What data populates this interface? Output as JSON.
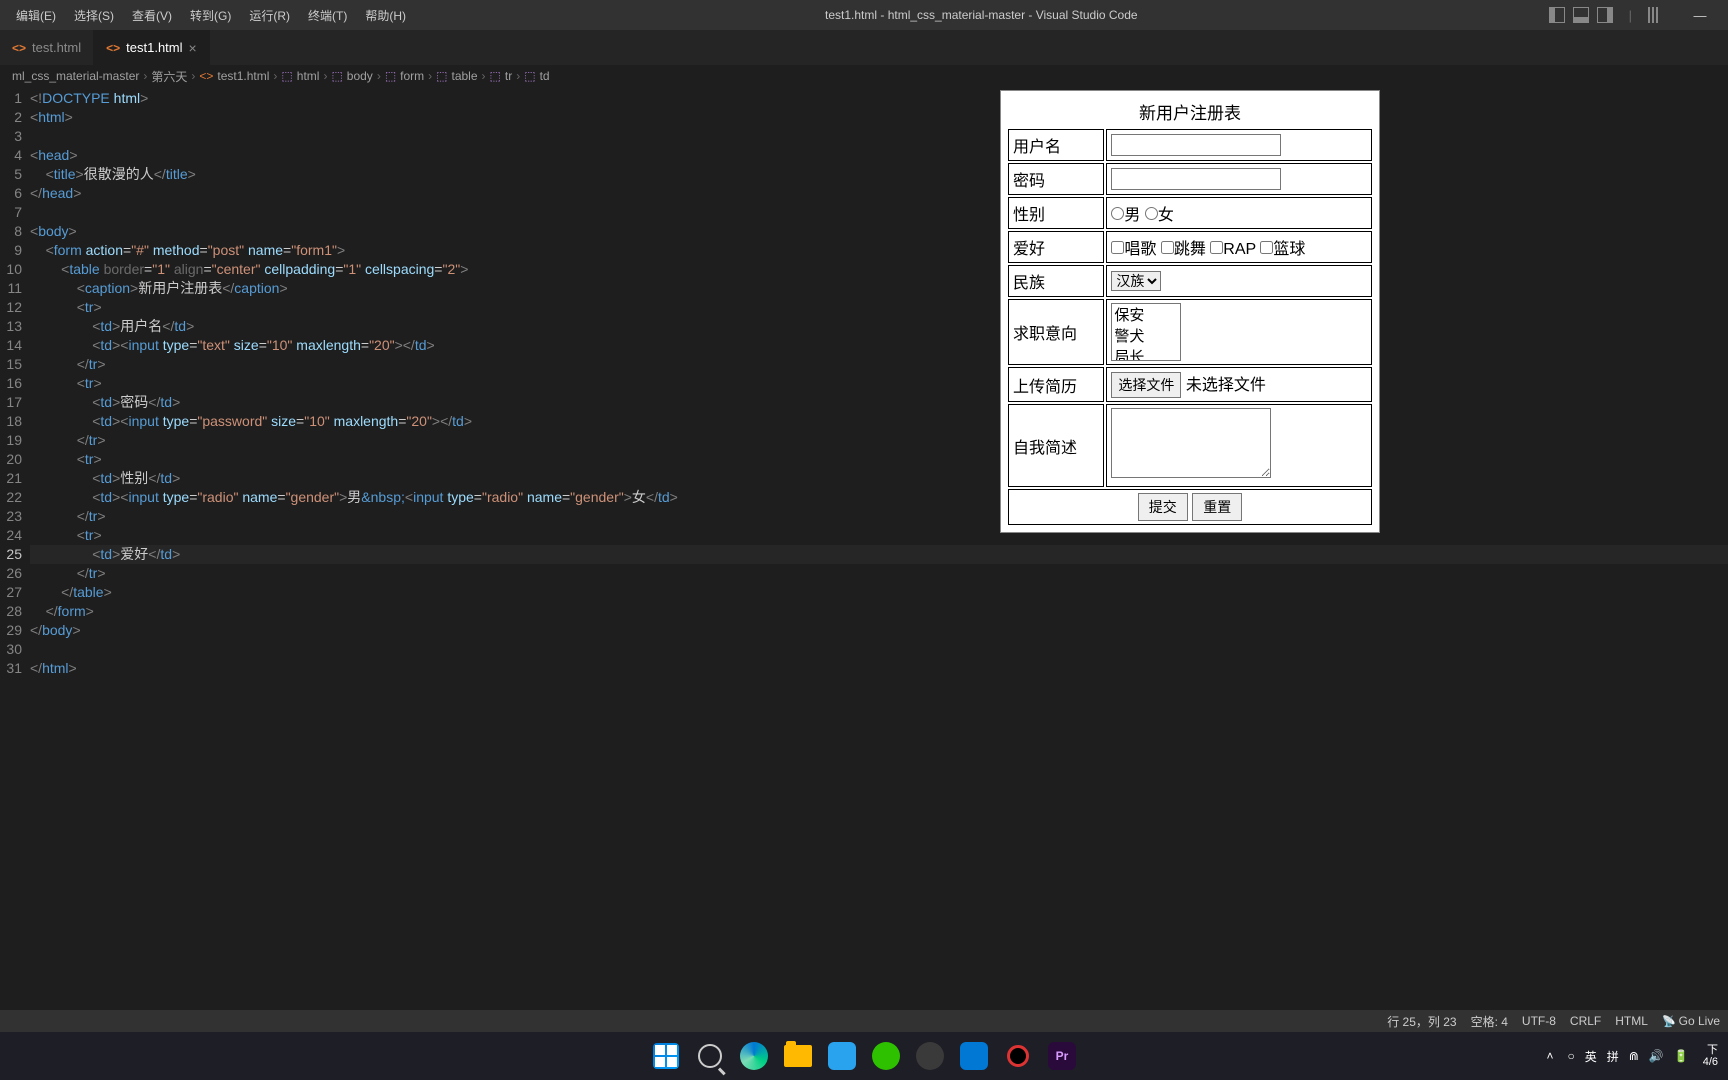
{
  "menubar": [
    "编辑(E)",
    "选择(S)",
    "查看(V)",
    "转到(G)",
    "运行(R)",
    "终端(T)",
    "帮助(H)"
  ],
  "window_title": "test1.html - html_css_material-master - Visual Studio Code",
  "tabs": [
    {
      "label": "test.html",
      "active": false
    },
    {
      "label": "test1.html",
      "active": true
    }
  ],
  "breadcrumb": [
    "ml_css_material-master",
    "第六天",
    "test1.html",
    "html",
    "body",
    "form",
    "table",
    "tr",
    "td"
  ],
  "code_lines": [
    {
      "n": 1,
      "html": "<span class='t-gray'>&lt;!</span><span class='t-doctype'>DOCTYPE</span> <span class='t-doctype2'>html</span><span class='t-gray'>&gt;</span>"
    },
    {
      "n": 2,
      "html": "<span class='t-gray'>&lt;</span><span class='t-tag'>html</span><span class='t-gray'>&gt;</span>"
    },
    {
      "n": 3,
      "html": ""
    },
    {
      "n": 4,
      "html": "<span class='t-gray'>&lt;</span><span class='t-tag'>head</span><span class='t-gray'>&gt;</span>"
    },
    {
      "n": 5,
      "html": "    <span class='t-gray'>&lt;</span><span class='t-tag'>title</span><span class='t-gray'>&gt;</span>很散漫的人<span class='t-gray'>&lt;/</span><span class='t-tag'>title</span><span class='t-gray'>&gt;</span>"
    },
    {
      "n": 6,
      "html": "<span class='t-gray'>&lt;/</span><span class='t-tag'>head</span><span class='t-gray'>&gt;</span>"
    },
    {
      "n": 7,
      "html": ""
    },
    {
      "n": 8,
      "html": "<span class='t-gray'>&lt;</span><span class='t-tag'>body</span><span class='t-gray'>&gt;</span>"
    },
    {
      "n": 9,
      "html": "    <span class='t-gray'>&lt;</span><span class='t-tag'>form</span> <span class='t-attr'>action</span>=<span class='t-str'>\"#\"</span> <span class='t-attr'>method</span>=<span class='t-str'>\"post\"</span> <span class='t-attr'>name</span>=<span class='t-str'>\"form1\"</span><span class='t-gray'>&gt;</span>"
    },
    {
      "n": 10,
      "html": "        <span class='t-gray'>&lt;</span><span class='t-tag'>table</span> <span class='t-dim'>border</span>=<span class='t-str'>\"1\"</span> <span class='t-dim'>align</span>=<span class='t-str'>\"center\"</span> <span class='t-attr'>cellpadding</span>=<span class='t-str'>\"1\"</span> <span class='t-attr'>cellspacing</span>=<span class='t-str'>\"2\"</span><span class='t-gray'>&gt;</span>"
    },
    {
      "n": 11,
      "html": "            <span class='t-gray'>&lt;</span><span class='t-tag'>caption</span><span class='t-gray'>&gt;</span>新用户注册表<span class='t-gray'>&lt;/</span><span class='t-tag'>caption</span><span class='t-gray'>&gt;</span>"
    },
    {
      "n": 12,
      "html": "            <span class='t-gray'>&lt;</span><span class='t-tag'>tr</span><span class='t-gray'>&gt;</span>"
    },
    {
      "n": 13,
      "html": "                <span class='t-gray'>&lt;</span><span class='t-tag'>td</span><span class='t-gray'>&gt;</span>用户名<span class='t-gray'>&lt;/</span><span class='t-tag'>td</span><span class='t-gray'>&gt;</span>"
    },
    {
      "n": 14,
      "html": "                <span class='t-gray'>&lt;</span><span class='t-tag'>td</span><span class='t-gray'>&gt;&lt;</span><span class='t-tag'>input</span> <span class='t-attr'>type</span>=<span class='t-str'>\"text\"</span> <span class='t-attr'>size</span>=<span class='t-str'>\"10\"</span> <span class='t-attr'>maxlength</span>=<span class='t-str'>\"20\"</span><span class='t-gray'>&gt;&lt;/</span><span class='t-tag'>td</span><span class='t-gray'>&gt;</span>"
    },
    {
      "n": 15,
      "html": "            <span class='t-gray'>&lt;/</span><span class='t-tag'>tr</span><span class='t-gray'>&gt;</span>"
    },
    {
      "n": 16,
      "html": "            <span class='t-gray'>&lt;</span><span class='t-tag'>tr</span><span class='t-gray'>&gt;</span>"
    },
    {
      "n": 17,
      "html": "                <span class='t-gray'>&lt;</span><span class='t-tag'>td</span><span class='t-gray'>&gt;</span>密码<span class='t-gray'>&lt;/</span><span class='t-tag'>td</span><span class='t-gray'>&gt;</span>"
    },
    {
      "n": 18,
      "html": "                <span class='t-gray'>&lt;</span><span class='t-tag'>td</span><span class='t-gray'>&gt;&lt;</span><span class='t-tag'>input</span> <span class='t-attr'>type</span>=<span class='t-str'>\"password\"</span> <span class='t-attr'>size</span>=<span class='t-str'>\"10\"</span> <span class='t-attr'>maxlength</span>=<span class='t-str'>\"20\"</span><span class='t-gray'>&gt;&lt;/</span><span class='t-tag'>td</span><span class='t-gray'>&gt;</span>"
    },
    {
      "n": 19,
      "html": "            <span class='t-gray'>&lt;/</span><span class='t-tag'>tr</span><span class='t-gray'>&gt;</span>"
    },
    {
      "n": 20,
      "html": "            <span class='t-gray'>&lt;</span><span class='t-tag'>tr</span><span class='t-gray'>&gt;</span>"
    },
    {
      "n": 21,
      "html": "                <span class='t-gray'>&lt;</span><span class='t-tag'>td</span><span class='t-gray'>&gt;</span>性别<span class='t-gray'>&lt;/</span><span class='t-tag'>td</span><span class='t-gray'>&gt;</span>"
    },
    {
      "n": 22,
      "html": "                <span class='t-gray'>&lt;</span><span class='t-tag'>td</span><span class='t-gray'>&gt;&lt;</span><span class='t-tag'>input</span> <span class='t-attr'>type</span>=<span class='t-str'>\"radio\"</span> <span class='t-attr'>name</span>=<span class='t-str'>\"gender\"</span><span class='t-gray'>&gt;</span>男<span class='t-tag'>&amp;nbsp;</span><span class='t-gray'>&lt;</span><span class='t-tag'>input</span> <span class='t-attr'>type</span>=<span class='t-str'>\"radio\"</span> <span class='t-attr'>name</span>=<span class='t-str'>\"gender\"</span><span class='t-gray'>&gt;</span>女<span class='t-gray'>&lt;/</span><span class='t-tag'>td</span><span class='t-gray'>&gt;</span>"
    },
    {
      "n": 23,
      "html": "            <span class='t-gray'>&lt;/</span><span class='t-tag'>tr</span><span class='t-gray'>&gt;</span>"
    },
    {
      "n": 24,
      "html": "            <span class='t-gray'>&lt;</span><span class='t-tag'>tr</span><span class='t-gray'>&gt;</span>"
    },
    {
      "n": 25,
      "html": "                <span class='t-gray'>&lt;</span><span class='t-tag'>td</span><span class='t-gray'>&gt;</span>爱好<span class='t-gray'>&lt;/</span><span class='t-tag'>td</span><span class='t-gray'>&gt;</span>",
      "active": true
    },
    {
      "n": 26,
      "html": "            <span class='t-gray'>&lt;/</span><span class='t-tag'>tr</span><span class='t-gray'>&gt;</span>"
    },
    {
      "n": 27,
      "html": "        <span class='t-gray'>&lt;/</span><span class='t-tag'>table</span><span class='t-gray'>&gt;</span>"
    },
    {
      "n": 28,
      "html": "    <span class='t-gray'>&lt;/</span><span class='t-tag'>form</span><span class='t-gray'>&gt;</span>"
    },
    {
      "n": 29,
      "html": "<span class='t-gray'>&lt;/</span><span class='t-tag'>body</span><span class='t-gray'>&gt;</span>"
    },
    {
      "n": 30,
      "html": ""
    },
    {
      "n": 31,
      "html": "<span class='t-gray'>&lt;/</span><span class='t-tag'>html</span><span class='t-gray'>&gt;</span>"
    }
  ],
  "form": {
    "caption": "新用户注册表",
    "rows": {
      "username": "用户名",
      "password": "密码",
      "gender": "性别",
      "gender_m": "男",
      "gender_f": "女",
      "hobby": "爱好",
      "hobbies": [
        "唱歌",
        "跳舞",
        "RAP",
        "篮球"
      ],
      "nation": "民族",
      "nation_opt": "汉族",
      "job": "求职意向",
      "job_opts": [
        "保安",
        "警犬",
        "局长"
      ],
      "resume": "上传简历",
      "file_btn": "选择文件",
      "file_status": "未选择文件",
      "desc": "自我简述",
      "submit": "提交",
      "reset": "重置"
    }
  },
  "statusbar": {
    "pos": "行 25，列 23",
    "spaces": "空格: 4",
    "enc": "UTF-8",
    "eol": "CRLF",
    "lang": "HTML",
    "golive": "Go Live"
  },
  "tray": {
    "ime1": "英",
    "ime2": "拼",
    "time_partial": "下",
    "date_partial": "4/6"
  }
}
